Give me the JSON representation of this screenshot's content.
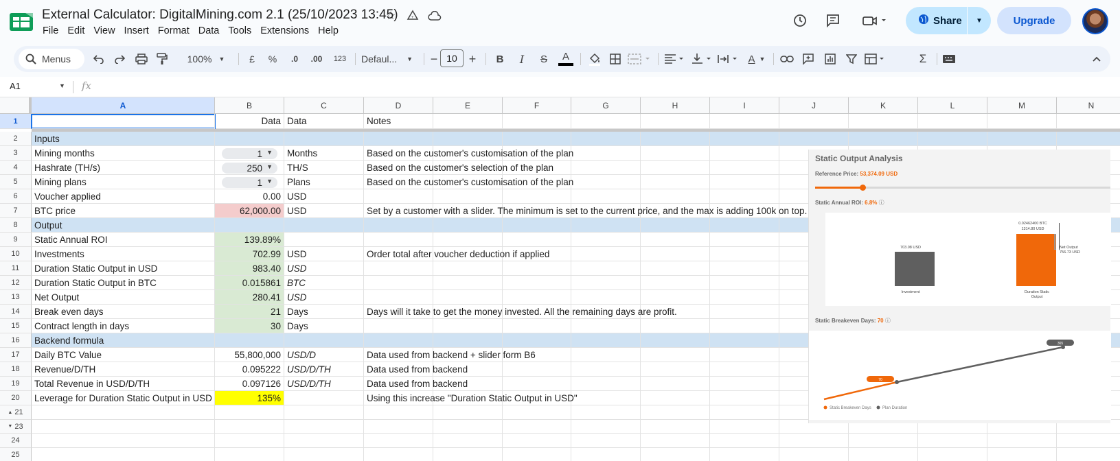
{
  "document": {
    "title": "External Calculator: DigitalMining.com 2.1 (25/10/2023 13:45)",
    "menu": [
      "File",
      "Edit",
      "View",
      "Insert",
      "Format",
      "Data",
      "Tools",
      "Extensions",
      "Help"
    ]
  },
  "header": {
    "share_label": "Share",
    "upgrade_label": "Upgrade"
  },
  "toolbar": {
    "menus_label": "Menus",
    "zoom": "100%",
    "currency": "£",
    "percent": "%",
    "dec_decrease": ".0",
    "dec_increase": ".00",
    "number_format": "123",
    "font": "Defaul...",
    "font_size": "10",
    "bold": "B",
    "italic": "I",
    "strike": "S",
    "text_color": "A",
    "more_formats": "A"
  },
  "formula_bar": {
    "cell_ref": "A1",
    "fx": "fx",
    "content": ""
  },
  "columns": [
    "A",
    "B",
    "C",
    "D",
    "E",
    "F",
    "G",
    "H",
    "I",
    "J",
    "K",
    "L",
    "M",
    "N"
  ],
  "rows": [
    {
      "n": "1",
      "a": "",
      "b": "Data",
      "c": "Data",
      "d": "Notes"
    },
    {
      "n": "2",
      "a": "Inputs",
      "b": "",
      "c": "",
      "d": "",
      "section": true
    },
    {
      "n": "3",
      "a": "Mining months",
      "b": "1",
      "c": "Months",
      "d": "Based on the customer's customisation of the plan",
      "dropdown": true
    },
    {
      "n": "4",
      "a": "Hashrate (TH/s)",
      "b": "250",
      "c": "TH/S",
      "d": "Based on the customer's selection of the plan",
      "dropdown": true
    },
    {
      "n": "5",
      "a": "Mining plans",
      "b": "1",
      "c": "Plans",
      "d": "Based on the customer's customisation of the plan",
      "dropdown": true
    },
    {
      "n": "6",
      "a": "Voucher applied",
      "b": "0.00",
      "c": "USD",
      "d": ""
    },
    {
      "n": "7",
      "a": "BTC price",
      "b": "62,000.00",
      "c": "USD",
      "d": "Set by a customer with a slider. The minimum is set to the current price, and the max is adding 100k on top.",
      "fill": "pink"
    },
    {
      "n": "8",
      "a": "Output",
      "b": "",
      "c": "",
      "d": "",
      "section": true
    },
    {
      "n": "9",
      "a": "Static Annual ROI",
      "b": "139.89%",
      "c": "",
      "d": "",
      "fill": "green"
    },
    {
      "n": "10",
      "a": "Investments",
      "b": "702.99",
      "c": "USD",
      "d": "Order total after voucher deduction if applied",
      "fill": "green"
    },
    {
      "n": "11",
      "a": "Duration Static Output in USD",
      "b": "983.40",
      "c": "USD",
      "d": "",
      "fill": "green",
      "c_italic": true
    },
    {
      "n": "12",
      "a": "Duration Static Output in BTC",
      "b": "0.015861",
      "c": "BTC",
      "d": "",
      "fill": "green",
      "c_italic": true
    },
    {
      "n": "13",
      "a": "Net Output",
      "b": "280.41",
      "c": "USD",
      "d": "",
      "fill": "green",
      "c_italic": true
    },
    {
      "n": "14",
      "a": "Break even days",
      "b": "21",
      "c": "Days",
      "d": "Days will it take to get the money invested. All the remaining days are profit.",
      "fill": "green"
    },
    {
      "n": "15",
      "a": "Contract length in days",
      "b": "30",
      "c": "Days",
      "d": "",
      "fill": "green"
    },
    {
      "n": "16",
      "a": "Backend formula",
      "b": "",
      "c": "",
      "d": "",
      "section": true
    },
    {
      "n": "17",
      "a": "Daily BTC Value",
      "b": "55,800,000",
      "c": "USD/D",
      "d": "Data used from backend + slider form B6",
      "c_italic": true
    },
    {
      "n": "18",
      "a": "Revenue/D/TH",
      "b": "0.095222",
      "c": "USD/D/TH",
      "d": "Data used from backend",
      "c_italic": true
    },
    {
      "n": "19",
      "a": "Total Revenue in USD/D/TH",
      "b": "0.097126",
      "c": "USD/D/TH",
      "d": "Data used from backend",
      "c_italic": true
    },
    {
      "n": "20",
      "a": "Leverage for Duration Static Output in USD",
      "b": "135%",
      "c": "",
      "d": "Using this increase \"Duration Static Output in USD\"",
      "fill": "yellow"
    },
    {
      "n": "21",
      "a": "",
      "b": "",
      "c": "",
      "d": "",
      "marker": "▲"
    },
    {
      "n": "23",
      "a": "",
      "b": "",
      "c": "",
      "d": "",
      "marker": "▼"
    },
    {
      "n": "24",
      "a": "",
      "b": "",
      "c": "",
      "d": ""
    },
    {
      "n": "25",
      "a": "",
      "b": "",
      "c": "",
      "d": ""
    }
  ],
  "overlay": {
    "title": "Static Output Analysis",
    "reference_label": "Reference Price:",
    "reference_value": "53,374.09 USD",
    "slider_fraction": 0.15,
    "roi_label": "Static Annual ROI:",
    "roi_value": "6.8%",
    "investment_bar_value": "703.08 USD",
    "investment_label": "Investment",
    "output_bar_btc": "0.02462400 BTC",
    "output_bar_usd": "1314.80 USD",
    "output_label_line1": "Duration Static",
    "output_label_line2": "Output",
    "net_output_label": "Net Output",
    "net_output_value": "756.73 USD",
    "breakeven_label": "Static Breakeven Days:",
    "breakeven_value": "70",
    "breakeven_pill": "70",
    "duration_pill": "365",
    "legend": [
      "Static Breakeven Days",
      "Plan Duration"
    ],
    "colors": {
      "accent": "#f0680a",
      "gray": "#5f5f5f"
    }
  }
}
